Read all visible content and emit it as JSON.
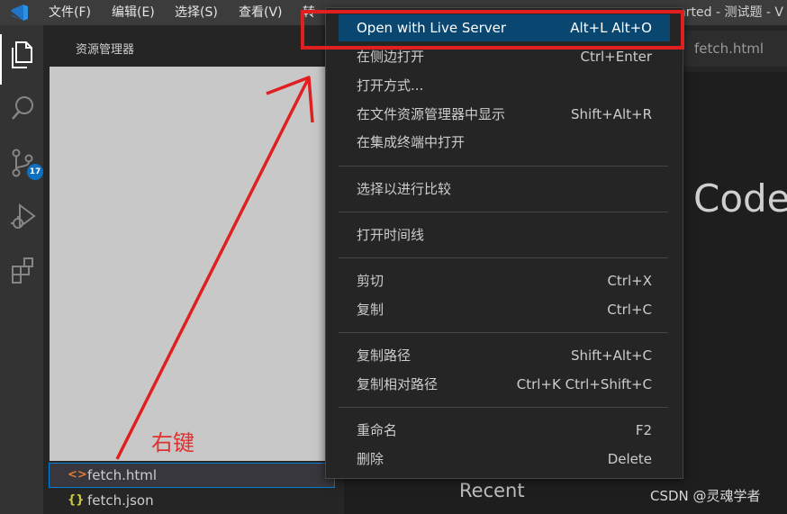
{
  "titlebar": {
    "menus": [
      "文件(F)",
      "编辑(E)",
      "选择(S)",
      "查看(V)",
      "转"
    ],
    "title": "tarted - 测试题 - V"
  },
  "activity": {
    "items": [
      {
        "name": "explorer",
        "icon": "files-icon",
        "active": true
      },
      {
        "name": "search",
        "icon": "search-icon"
      },
      {
        "name": "source-control",
        "icon": "source-control-icon",
        "badge": "17"
      },
      {
        "name": "run-debug",
        "icon": "debug-icon"
      },
      {
        "name": "extensions",
        "icon": "extensions-icon"
      }
    ]
  },
  "sidebar": {
    "title": "资源管理器",
    "files": [
      {
        "icon": "<>",
        "label": "fetch.html",
        "selected": true
      },
      {
        "icon": "{}",
        "label": "fetch.json",
        "selected": false
      }
    ]
  },
  "editor": {
    "tab": "fetch.html",
    "welcome_text": "Code",
    "recent_label": "Recent"
  },
  "context_menu": {
    "groups": [
      [
        {
          "label": "Open with Live Server",
          "shortcut": "Alt+L Alt+O",
          "highlight": true
        },
        {
          "label": "在侧边打开",
          "shortcut": "Ctrl+Enter"
        },
        {
          "label": "打开方式...",
          "shortcut": ""
        },
        {
          "label": "在文件资源管理器中显示",
          "shortcut": "Shift+Alt+R"
        },
        {
          "label": "在集成终端中打开",
          "shortcut": ""
        }
      ],
      [
        {
          "label": "选择以进行比较",
          "shortcut": ""
        }
      ],
      [
        {
          "label": "打开时间线",
          "shortcut": ""
        }
      ],
      [
        {
          "label": "剪切",
          "shortcut": "Ctrl+X"
        },
        {
          "label": "复制",
          "shortcut": "Ctrl+C"
        }
      ],
      [
        {
          "label": "复制路径",
          "shortcut": "Shift+Alt+C"
        },
        {
          "label": "复制相对路径",
          "shortcut": "Ctrl+K Ctrl+Shift+C"
        }
      ],
      [
        {
          "label": "重命名",
          "shortcut": "F2"
        },
        {
          "label": "删除",
          "shortcut": "Delete"
        }
      ]
    ]
  },
  "annotation": {
    "text": "右键",
    "color": "#e02020"
  },
  "watermark": "CSDN @灵魂学者",
  "colors": {
    "highlight": "#094771",
    "badge": "#0e70c0",
    "accent": "#007fd4"
  }
}
